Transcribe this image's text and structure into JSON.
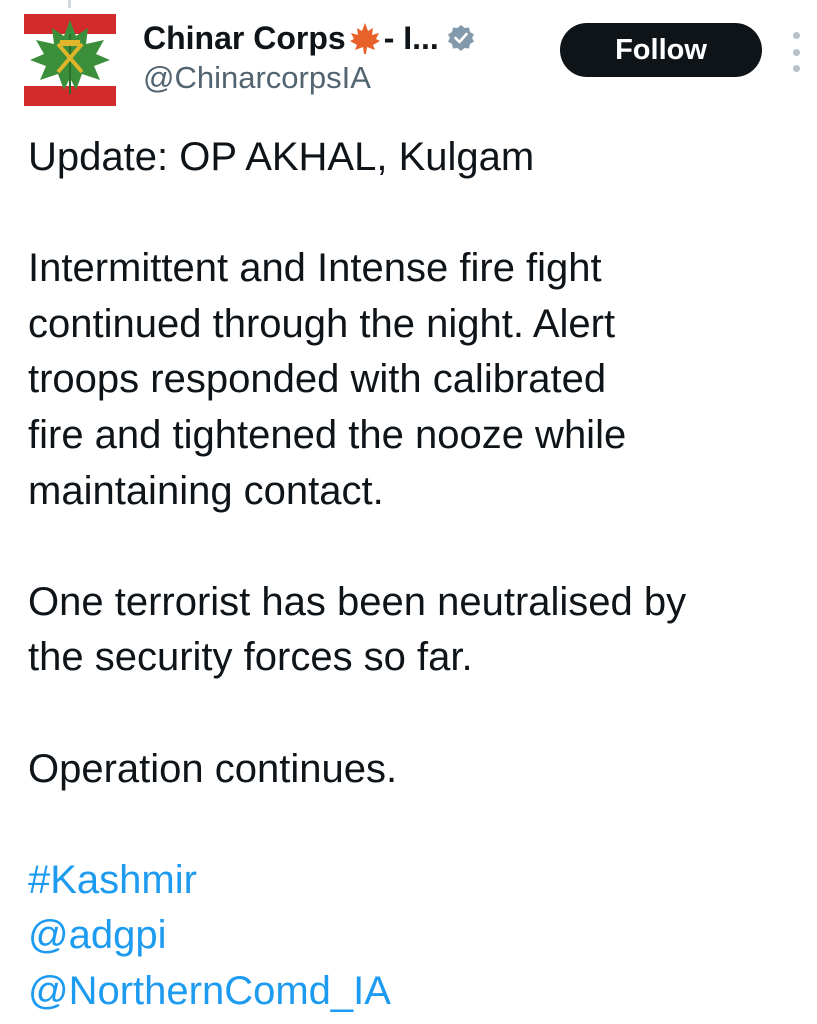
{
  "author": {
    "display_name": "Chinar Corps",
    "name_suffix": " - I...",
    "handle": "@ChinarcorpsIA",
    "verified": true
  },
  "header": {
    "follow_label": "Follow"
  },
  "tweet": {
    "line1": "Update: OP AKHAL, Kulgam",
    "para1": [
      "Intermittent and Intense fire fight",
      "continued through the night. Alert",
      "troops responded with calibrated",
      "fire and tightened the nooze while",
      "maintaining contact."
    ],
    "para2": [
      "One terrorist has been neutralised by",
      "the security forces so far."
    ],
    "para3": "Operation continues.",
    "hashtag": "#Kashmir",
    "mention1": "@adgpi",
    "mention2": "@NorthernComd_IA"
  },
  "colors": {
    "link": "#1d9bf0",
    "text": "#0f1419",
    "secondary": "#536471",
    "follow_bg": "#0f1419",
    "avatar_red": "#d32b2b",
    "avatar_green": "#3c8f3a"
  },
  "icons": {
    "avatar": "chinar-leaf-emblem",
    "emoji": "maple-leaf-icon",
    "verified": "verified-badge-icon",
    "more": "more-options-icon"
  }
}
